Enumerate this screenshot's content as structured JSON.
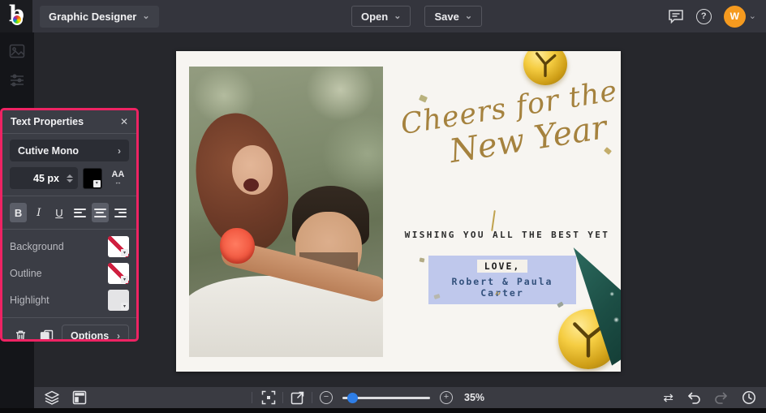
{
  "topbar": {
    "app_menu_label": "Graphic Designer",
    "open_label": "Open",
    "save_label": "Save",
    "help_glyph": "?",
    "avatar_initial": "W"
  },
  "icons": {
    "chevron_down": "⌄",
    "chevron_right": "›",
    "close": "✕",
    "minus": "−",
    "plus": "+",
    "letter_spacing": "AA",
    "letter_spacing_arrow": "↔",
    "compare": "⇄",
    "undo": "↶",
    "redo": "↷",
    "quote": "”",
    "logo_letter": "b"
  },
  "panel": {
    "title": "Text Properties",
    "font_name": "Cutive Mono",
    "font_size_value": "45 px",
    "bold_label": "B",
    "italic_label": "I",
    "underline_label": "U",
    "background_label": "Background",
    "outline_label": "Outline",
    "highlight_label": "Highlight",
    "options_label": "Options"
  },
  "canvas": {
    "script_line1": "Cheers for the",
    "script_line2": "New Year",
    "wishing_line": "WISHING YOU ALL THE BEST YET",
    "love_line": "LOVE,",
    "names_line": "Robert & Paula Carter"
  },
  "bottombar": {
    "zoom_level": "35%"
  },
  "colors": {
    "accent_pink": "#ee2363",
    "avatar_orange": "#f59a1f",
    "slider_blue": "#2e7ee7",
    "gold_script": "#a5823e",
    "selection_periwinkle": "#bfc8ec",
    "names_blue": "#33517c",
    "swatch_none_red": "#cf1f3f"
  }
}
